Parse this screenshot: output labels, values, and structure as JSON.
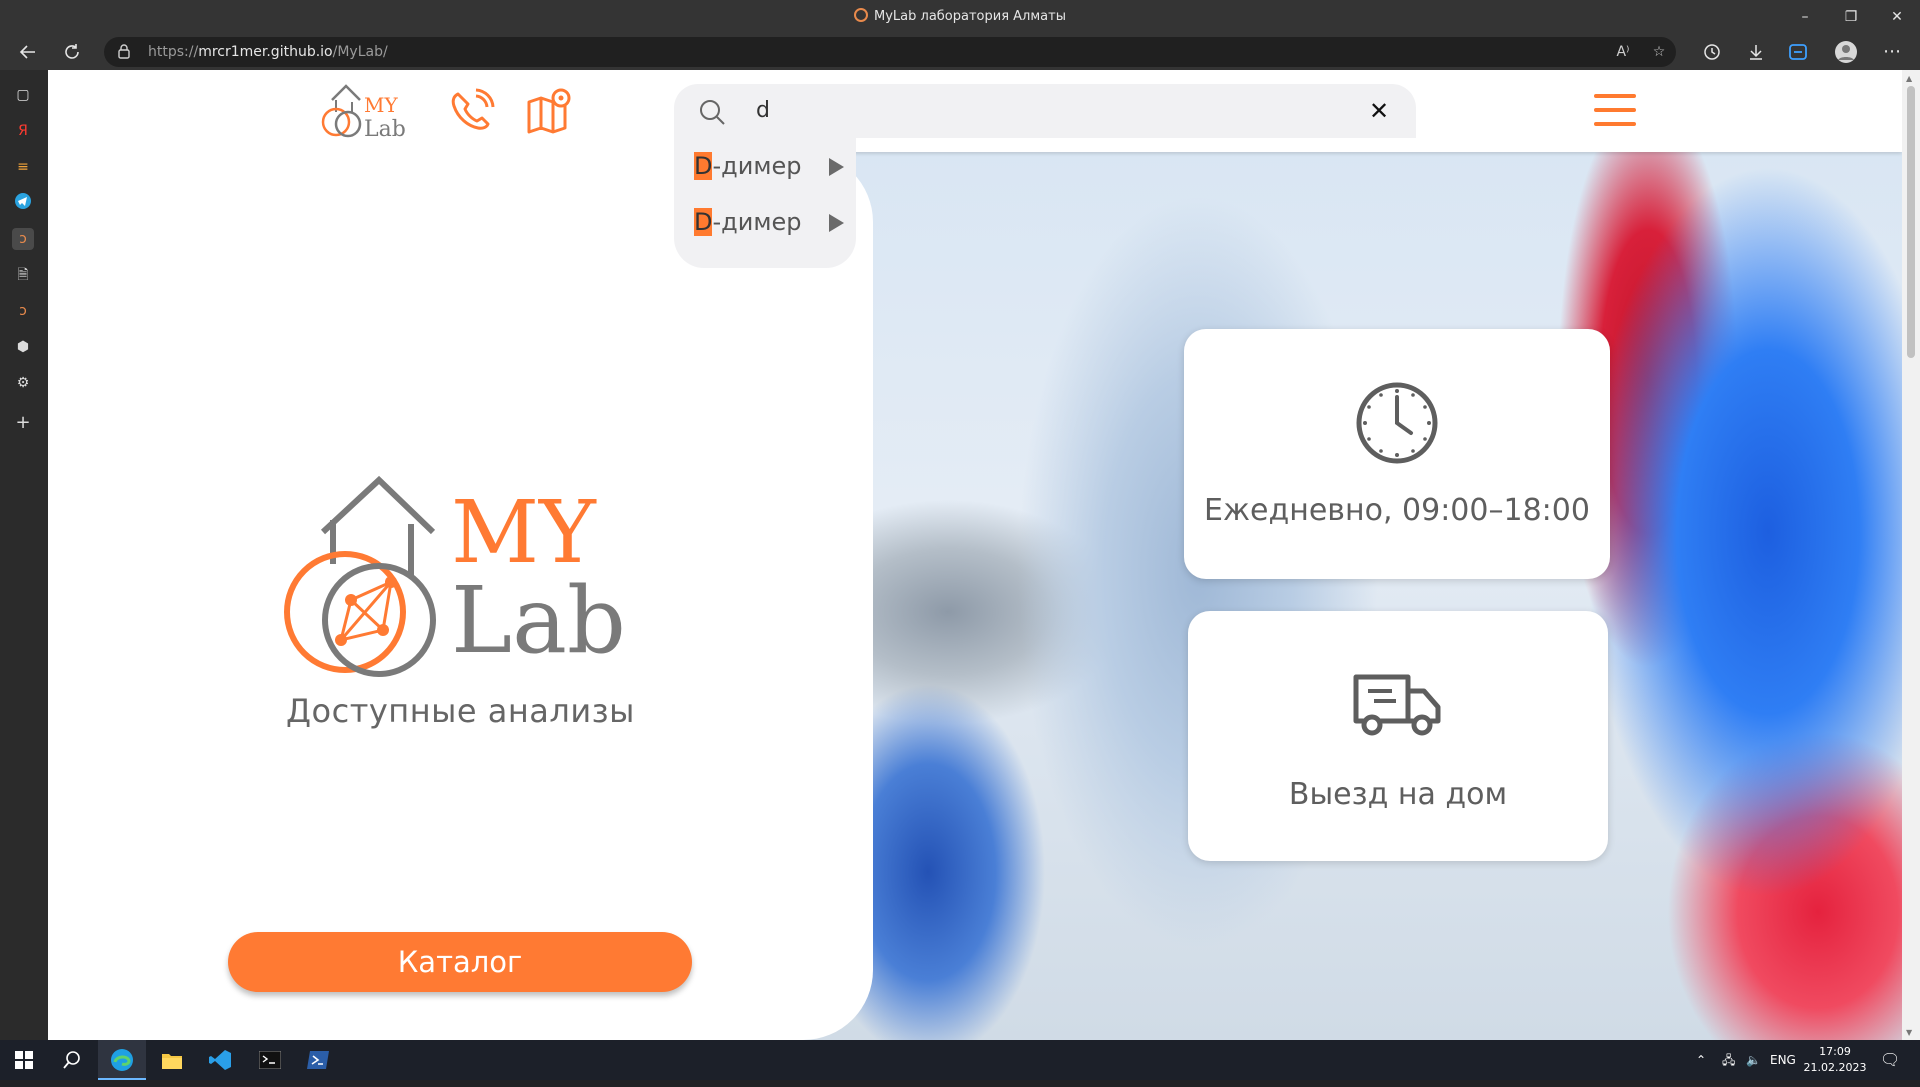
{
  "window": {
    "title": "MyLab лаборатория Алматы",
    "controls": {
      "minimize": "–",
      "restore": "❐",
      "close": "✕"
    }
  },
  "browser": {
    "url_prefix": "https://",
    "url_host": "mrcr1mer.github.io",
    "url_path": "/MyLab/",
    "read_aloud": "A⁾"
  },
  "header": {
    "logo_alt": "MY Lab"
  },
  "search": {
    "value": "d",
    "clear_label": "✕",
    "suggestions": [
      {
        "highlight": "D",
        "rest": "-димер"
      },
      {
        "highlight": "D",
        "rest": "-димер"
      }
    ]
  },
  "hero": {
    "logo_my": "MY",
    "logo_lab": "Lab",
    "subtitle": "Доступные анализы",
    "catalog_button": "Каталог"
  },
  "cards": {
    "hours": "Ежедневно, 09:00–18:00",
    "home_visit": "Выезд на дом"
  },
  "taskbar": {
    "lang": "ENG",
    "time": "17:09",
    "date": "21.02.2023"
  },
  "colors": {
    "accent": "#ff7a33",
    "logo_gray": "#7a7a7a"
  }
}
